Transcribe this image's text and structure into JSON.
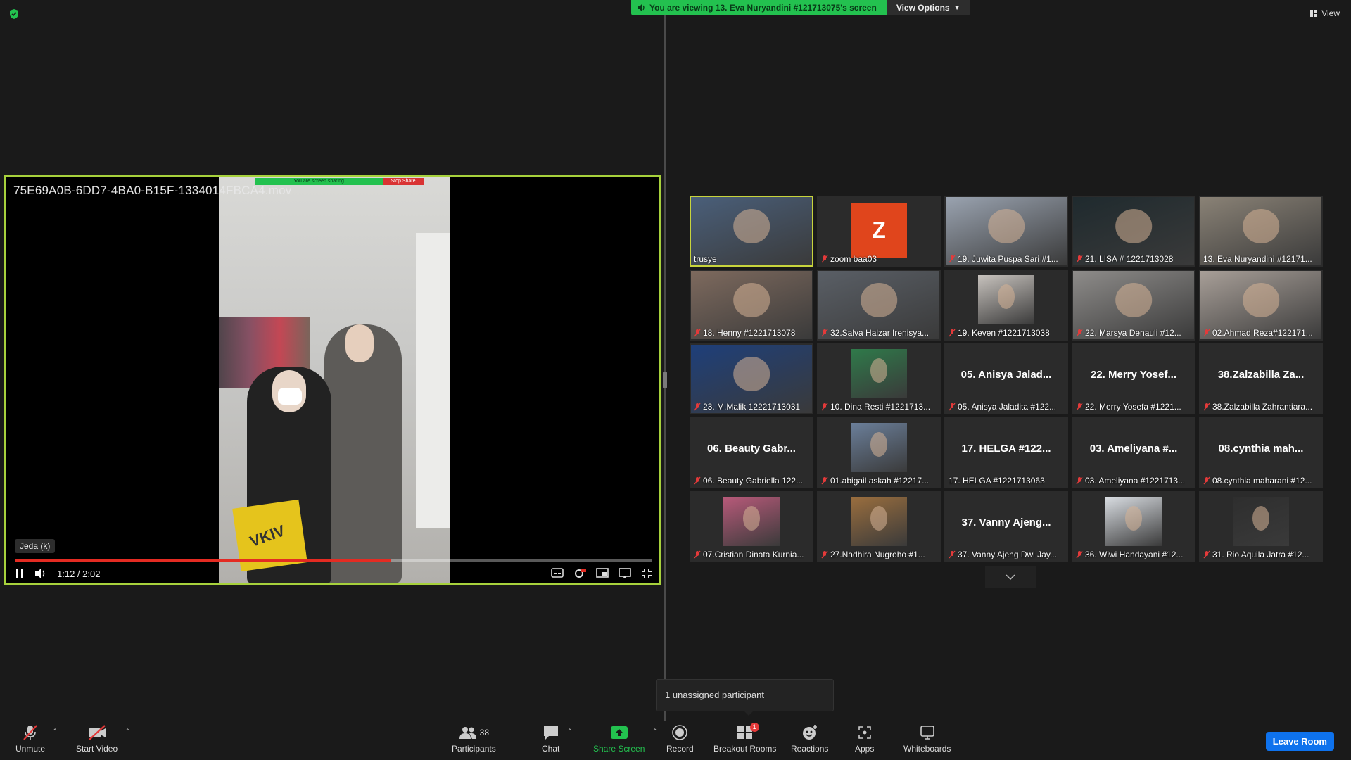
{
  "top": {
    "banner_text": "You are viewing 13. Eva Nuryandini #121713075's screen",
    "view_options": "View Options",
    "view_label": "View"
  },
  "shared": {
    "file_title": "75E69A0B-6DD7-4BA0-B15F-1334014FBCA4.mov",
    "mini_banner": "You are screen sharing",
    "mini_stop": "Stop Share",
    "bag_text": "VKIV",
    "tooltip": "Jeda (k)",
    "time": "1:12 / 2:02",
    "progress": 0.59
  },
  "gallery": [
    {
      "type": "video",
      "label": "trusye",
      "muted": false,
      "active": true,
      "tone": "#4a5f7a"
    },
    {
      "type": "avatar",
      "avatar_letter": "Z",
      "label": "zoom baa03",
      "muted": true
    },
    {
      "type": "video",
      "label": "19. Juwita Puspa Sari #1...",
      "muted": true,
      "tone": "#9aa3b0"
    },
    {
      "type": "video",
      "label": "21. LISA # 1221713028",
      "muted": true,
      "tone": "#1f2a2e"
    },
    {
      "type": "video",
      "label": "13. Eva Nuryandini #12171...",
      "muted": false,
      "tone": "#8a8276"
    },
    {
      "type": "video",
      "label": "18. Henny #1221713078",
      "muted": true,
      "tone": "#7e6a5e"
    },
    {
      "type": "video",
      "label": "32.Salva Halzar Irenisya...",
      "muted": true,
      "tone": "#5a5f66"
    },
    {
      "type": "video-small",
      "label": "19. Keven #1221713038",
      "muted": true,
      "tone": "#c7c2bd"
    },
    {
      "type": "video",
      "label": "22. Marsya Denauli #12...",
      "muted": true,
      "tone": "#8e8c8a"
    },
    {
      "type": "video",
      "label": "02.Ahmad Reza#122171...",
      "muted": true,
      "tone": "#a89f98"
    },
    {
      "type": "video",
      "label": "23. M.Malik 12221713031",
      "muted": true,
      "tone": "#1e3f7a"
    },
    {
      "type": "video-small",
      "label": "10. Dina Resti #1221713...",
      "muted": true,
      "tone": "#2f7a4a"
    },
    {
      "type": "name",
      "display": "05. Anisya Jalad...",
      "label": "05. Anisya Jaladita #122...",
      "muted": true
    },
    {
      "type": "name",
      "display": "22. Merry Yosef...",
      "label": "22. Merry Yosefa #1221...",
      "muted": true
    },
    {
      "type": "name",
      "display": "38.Zalzabilla Za...",
      "label": "38.Zalzabilla Zahrantiara...",
      "muted": true
    },
    {
      "type": "name",
      "display": "06. Beauty Gabr...",
      "label": "06. Beauty Gabriella 122...",
      "muted": true
    },
    {
      "type": "video-small",
      "label": "01.abigail askah #12217...",
      "muted": true,
      "tone": "#6b7f9a"
    },
    {
      "type": "name",
      "display": "17. HELGA #122...",
      "label": "17. HELGA #1221713063",
      "muted": false
    },
    {
      "type": "name",
      "display": "03. Ameliyana #...",
      "label": "03. Ameliyana #1221713...",
      "muted": true
    },
    {
      "type": "name",
      "display": "08.cynthia mah...",
      "label": "08.cynthia maharani #12...",
      "muted": true
    },
    {
      "type": "video-small",
      "label": "07.Cristian Dinata Kurnia...",
      "muted": true,
      "tone": "#b85a7a"
    },
    {
      "type": "video-small",
      "label": "27.Nadhira Nugroho #1...",
      "muted": true,
      "tone": "#9a6e3e"
    },
    {
      "type": "name",
      "display": "37. Vanny Ajeng...",
      "label": "37. Vanny Ajeng Dwi Jay...",
      "muted": true
    },
    {
      "type": "video-small",
      "label": "36. Wiwi Handayani #12...",
      "muted": true,
      "tone": "#d9dde2"
    },
    {
      "type": "video-small",
      "label": "31. Rio Aquila Jatra #12...",
      "muted": true,
      "tone": "#2e2e2e"
    }
  ],
  "popover": "1 unassigned participant",
  "toolbar": {
    "unmute": "Unmute",
    "start_video": "Start Video",
    "participants": "Participants",
    "participants_count": "38",
    "chat": "Chat",
    "share_screen": "Share Screen",
    "record": "Record",
    "breakout": "Breakout Rooms",
    "breakout_badge": "1",
    "reactions": "Reactions",
    "apps": "Apps",
    "whiteboards": "Whiteboards",
    "leave": "Leave Room"
  },
  "colors": {
    "accent_green": "#23c14f",
    "active_border": "#c8d43c",
    "shared_border": "#a7d13c",
    "leave_blue": "#0e72ed",
    "mute_red": "#e43a3a"
  }
}
